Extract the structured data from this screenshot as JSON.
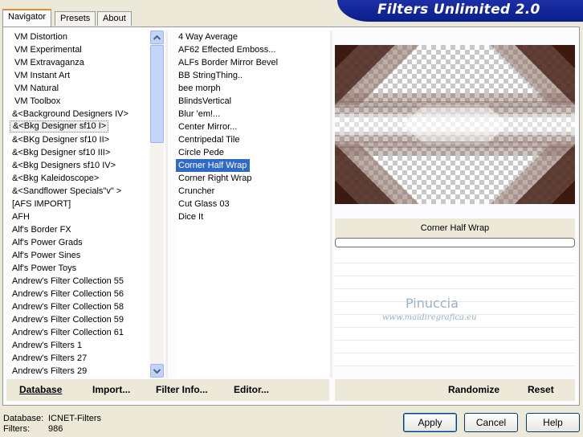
{
  "tabs": [
    "Navigator",
    "Presets",
    "About"
  ],
  "title": "Filters Unlimited 2.0",
  "categories": [
    "VM Distortion",
    "VM Experimental",
    "VM Extravaganza",
    "VM Instant Art",
    "VM Natural",
    "VM Toolbox",
    "&<Background Designers IV>",
    "&<Bkg Designer sf10 I>",
    "&<BKg Designer sf10 II>",
    "&<Bkg Designer sf10 III>",
    "&<Bkg Designers sf10 IV>",
    "&<Bkg Kaleidoscope>",
    "&<Sandflower Specials\"v\" >",
    "[AFS IMPORT]",
    "AFH",
    "Alf's Border FX",
    "Alf's Power Grads",
    "Alf's Power Sines",
    "Alf's Power Toys",
    "Andrew's Filter Collection 55",
    "Andrew's Filter Collection 56",
    "Andrew's Filter Collection 58",
    "Andrew's Filter Collection 59",
    "Andrew's Filter Collection 61",
    "Andrew's Filters 1",
    "Andrew's Filters 27",
    "Andrew's Filters 29"
  ],
  "selected_category": "&<Bkg Designer sf10 I>",
  "filters": [
    "4 Way Average",
    "AF62 Effected Emboss...",
    "ALFs Border Mirror Bevel",
    "BB StringThing..",
    "bee morph",
    "BlindsVertical",
    "Blur 'em!...",
    "Center Mirror...",
    "Centripedal Tile",
    "Circle Pede",
    "Corner Half Wrap",
    "Corner Right Wrap",
    "Cruncher",
    "Cut Glass 03",
    "Dice It"
  ],
  "selected_filter": "Corner Half Wrap",
  "preview_caption": "Corner Half Wrap",
  "watermark": {
    "name": "Pinuccia",
    "site": "www.maidiregrafica.eu"
  },
  "toolbar": {
    "database": "Database",
    "import": "Import...",
    "filter_info": "Filter Info...",
    "editor": "Editor...",
    "randomize": "Randomize",
    "reset": "Reset"
  },
  "status": {
    "database_label": "Database:",
    "database_value": "ICNET-Filters",
    "filters_label": "Filters:",
    "filters_value": "986"
  },
  "buttons": {
    "apply": "Apply",
    "cancel": "Cancel",
    "help": "Help"
  },
  "colors": {
    "selection": "#316ac5",
    "banner": "#1c2fa6",
    "face": "#ece9d8",
    "preview_brown": "#3d1a10"
  }
}
